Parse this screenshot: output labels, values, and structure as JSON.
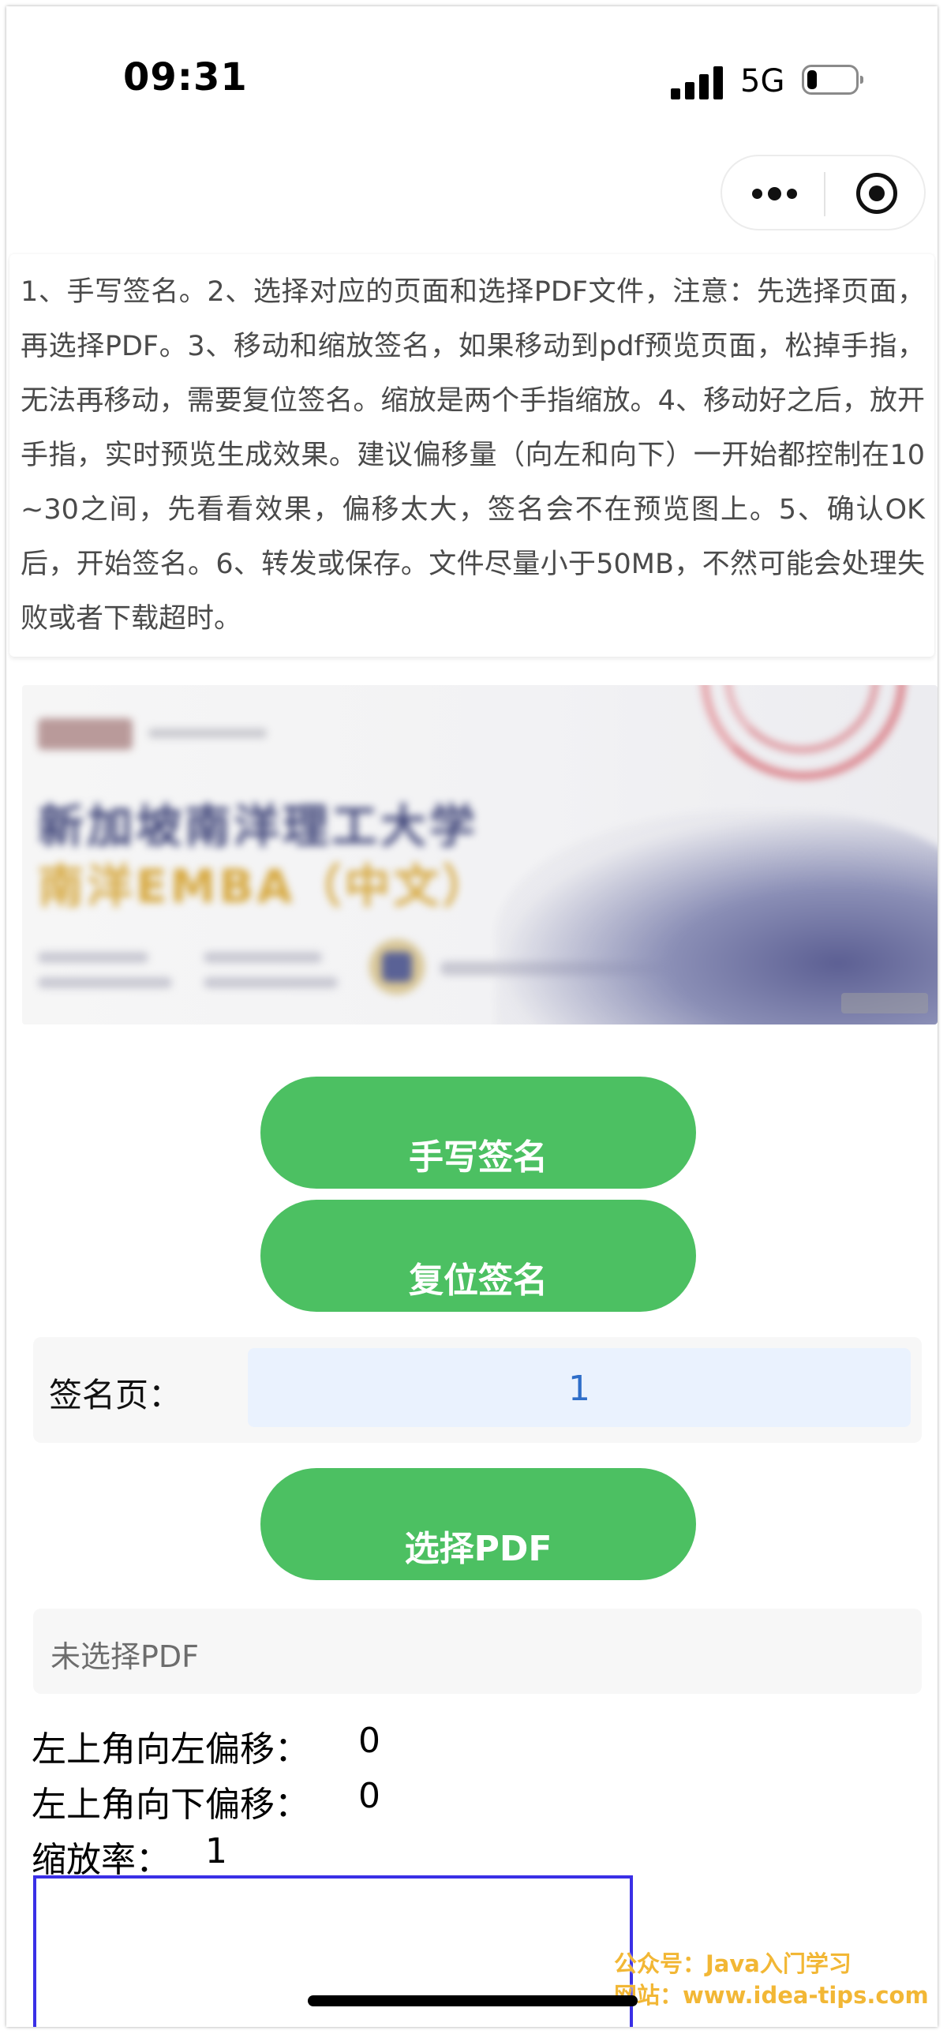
{
  "status_bar": {
    "time": "09:31",
    "network": "5G",
    "signal_bars": 4,
    "battery_level": 0.2
  },
  "capsule": {
    "more_icon": "more-dots-icon",
    "close_icon": "target-circle-icon"
  },
  "instructions": {
    "text": "1、手写签名。2、选择对应的页面和选择PDF文件，注意：先选择页面，再选择PDF。3、移动和缩放签名，如果移动到pdf预览页面，松掉手指，无法再移动，需要复位签名。缩放是两个手指缩放。4、移动好之后，放开手指，实时预览生成效果。建议偏移量（向左和向下）一开始都控制在10~30之间，先看看效果，偏移太大，签名会不在预览图上。5、确认OK后，开始签名。6、转发或保存。文件尽量小于50MB，不然可能会处理失败或者下载超时。"
  },
  "ad_banner": {
    "line1": "新加坡南洋理工大学",
    "line2": "南洋EMBA（中文）"
  },
  "buttons": {
    "handwrite": "手写签名",
    "reset": "复位签名",
    "select_pdf": "选择PDF"
  },
  "page_picker": {
    "label": "签名页：",
    "value": "1"
  },
  "pdf_status": {
    "text": "未选择PDF"
  },
  "offsets": {
    "left_label": "左上角向左偏移：",
    "left_value": "0",
    "down_label": "左上角向下偏移：",
    "down_value": "0",
    "scale_label": "缩放率：",
    "scale_value": "1"
  },
  "watermark": {
    "line1": "公众号：Java入门学习",
    "line2": "网站：www.idea-tips.com"
  },
  "colors": {
    "button_green": "#4cc062",
    "picker_bg": "#eaf2fe",
    "picker_text": "#2f6ec9",
    "preview_border": "#3a2fe6",
    "watermark": "#f2b735"
  }
}
